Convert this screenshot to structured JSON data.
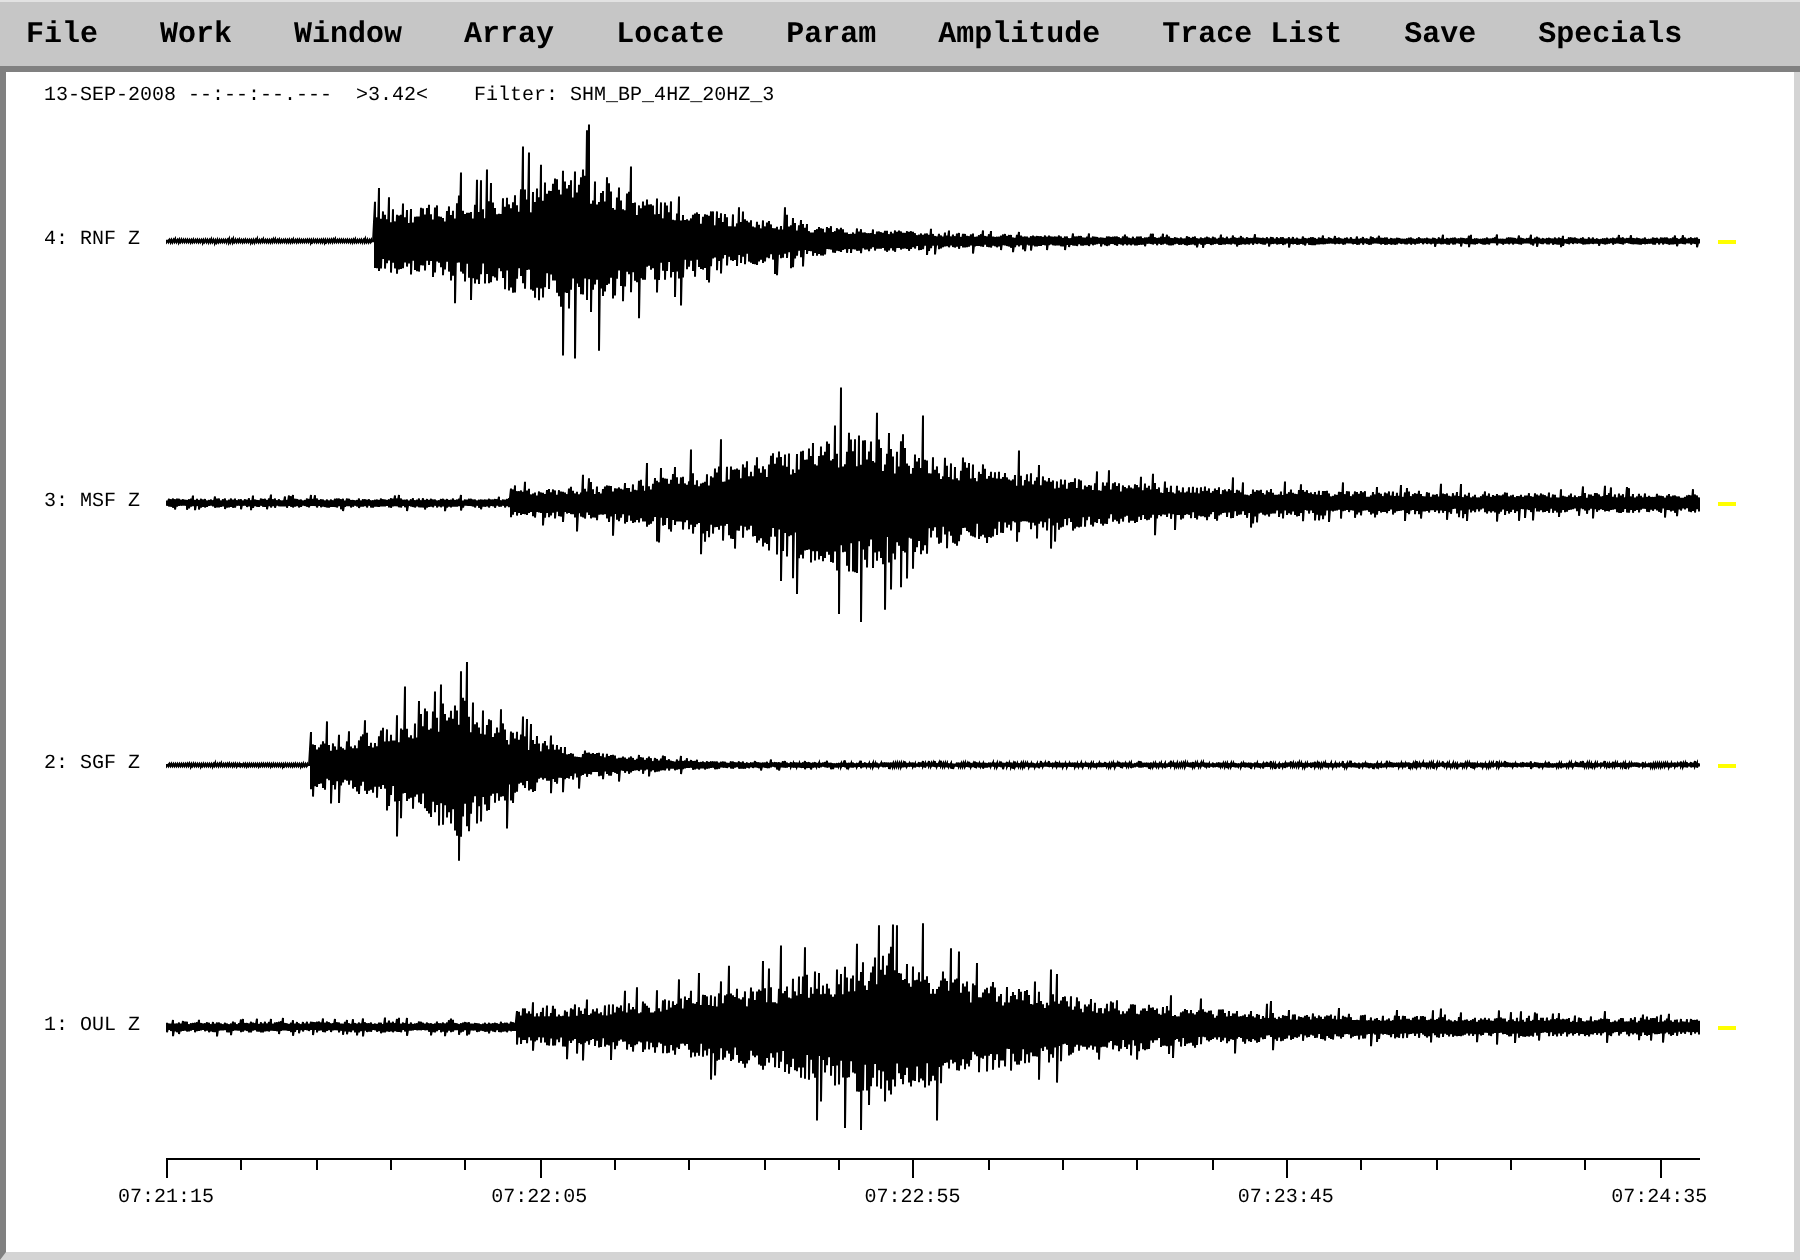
{
  "menu_bar": {
    "items": [
      "File",
      "Work",
      "Window",
      "Array",
      "Locate",
      "Param",
      "Amplitude",
      "Trace List",
      "Save",
      "Specials"
    ]
  },
  "header": {
    "date_time": "13-SEP-2008 --:--:--.---",
    "scale": ">3.42<",
    "filter": "Filter: SHM_BP_4HZ_20HZ_3"
  },
  "traces": [
    {
      "label": "4: RNF Z"
    },
    {
      "label": "3: MSF Z"
    },
    {
      "label": "2: SGF Z"
    },
    {
      "label": "1: OUL Z"
    }
  ],
  "time_axis": {
    "labels": [
      "07:21:15",
      "07:22:05",
      "07:22:55",
      "07:23:45",
      "07:24:35"
    ]
  }
}
